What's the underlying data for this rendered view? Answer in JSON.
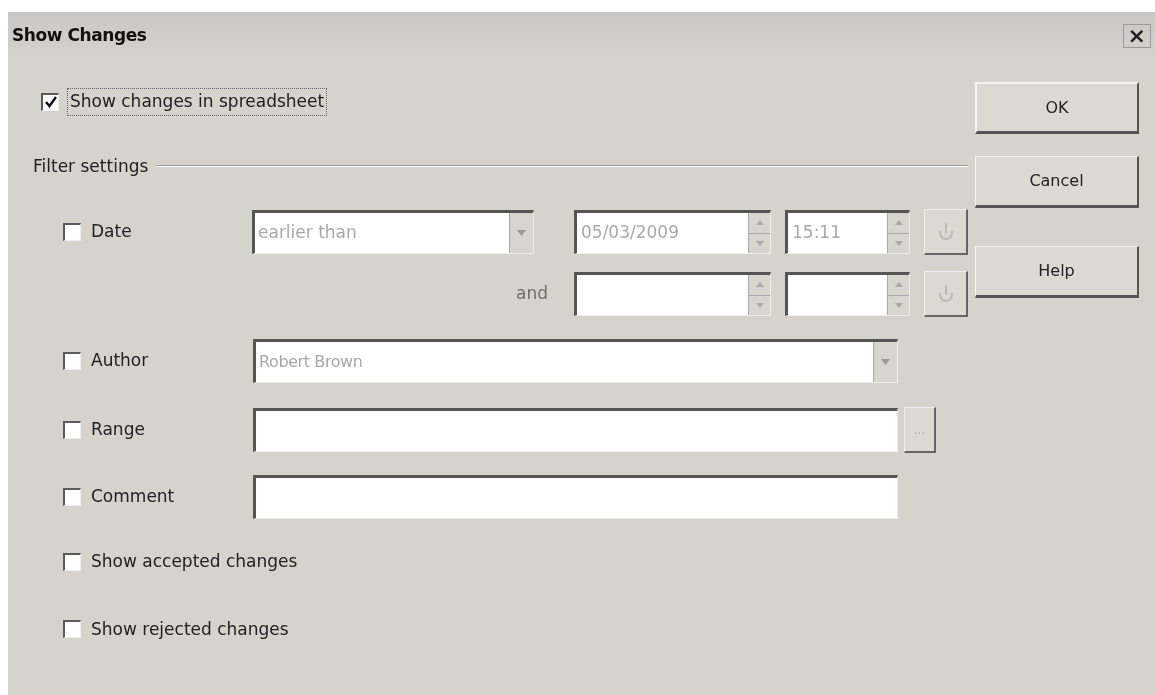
{
  "window": {
    "title": "Show Changes",
    "close": "×"
  },
  "show_changes": {
    "label": "Show changes in spreadsheet",
    "checked": true
  },
  "filter_settings": {
    "title": "Filter settings",
    "date": {
      "label": "Date",
      "checked": false,
      "condition": {
        "value": "earlier than",
        "disabled": true
      },
      "start_date": {
        "value": "05/03/2009",
        "disabled": true
      },
      "start_time": {
        "value": "15:11",
        "disabled": true
      },
      "and_label": "and"
    },
    "author": {
      "label": "Author",
      "checked": false,
      "value": "Robert Brown",
      "disabled": true
    },
    "range": {
      "label": "Range",
      "checked": false,
      "button": "..."
    },
    "comment": {
      "label": "Comment",
      "checked": false
    },
    "show_accepted": {
      "label": "Show accepted changes",
      "checked": false
    },
    "show_rejected": {
      "label": "Show rejected changes",
      "checked": false
    }
  },
  "buttons": [
    "OK",
    "Cancel",
    "Help"
  ]
}
